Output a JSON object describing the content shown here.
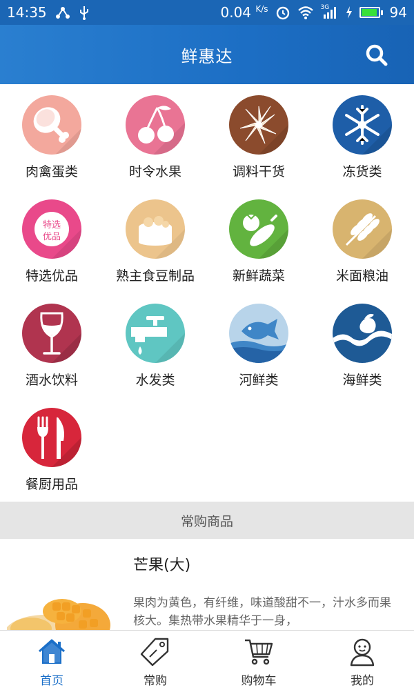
{
  "status_bar": {
    "time": "14:35",
    "net_speed": "0.04",
    "net_speed_unit": "K/s",
    "network": "3G",
    "battery": "94",
    "battery_level": 0.94,
    "icons": [
      "share-icon",
      "usb-icon",
      "alarm-icon",
      "wifi-icon",
      "signal-icon",
      "charging-icon",
      "battery-icon"
    ]
  },
  "header": {
    "title": "鲜惠达",
    "search_icon": "search-icon"
  },
  "categories": [
    {
      "label": "肉禽蛋类",
      "icon": "drumstick-icon",
      "color": "#f3a89d"
    },
    {
      "label": "时令水果",
      "icon": "cherry-icon",
      "color": "#e97494"
    },
    {
      "label": "调料干货",
      "icon": "star-anise-icon",
      "color": "#8b4b2d"
    },
    {
      "label": "冻货类",
      "icon": "snowflake-icon",
      "color": "#1e5ea8"
    },
    {
      "label": "特选优品",
      "icon": "premium-badge-icon",
      "color": "#e9498a",
      "badge_text": "特选优品"
    },
    {
      "label": "熟主食豆制品",
      "icon": "steamer-icon",
      "color": "#ecc48c"
    },
    {
      "label": "新鲜蔬菜",
      "icon": "vegetables-icon",
      "color": "#62b33f"
    },
    {
      "label": "米面粮油",
      "icon": "wheat-icon",
      "color": "#d8b46f"
    },
    {
      "label": "酒水饮料",
      "icon": "wine-glass-icon",
      "color": "#b0344f"
    },
    {
      "label": "水发类",
      "icon": "faucet-icon",
      "color": "#5fc6c2"
    },
    {
      "label": "河鲜类",
      "icon": "fish-icon",
      "color": "#b8d4ea"
    },
    {
      "label": "海鲜类",
      "icon": "wave-icon",
      "color": "#1e5a95"
    },
    {
      "label": "餐厨用品",
      "icon": "fork-knife-icon",
      "color": "#d7263b"
    }
  ],
  "section": {
    "title": "常购商品"
  },
  "product": {
    "name": "芒果(大)",
    "description": "果肉为黄色，有纤维，味道酸甜不一，汁水多而果核大。集热带水果精华于一身，"
  },
  "bottom_nav": [
    {
      "label": "首页",
      "icon": "home-icon",
      "active": true
    },
    {
      "label": "常购",
      "icon": "tag-icon",
      "active": false
    },
    {
      "label": "购物车",
      "icon": "cart-icon",
      "active": false
    },
    {
      "label": "我的",
      "icon": "user-icon",
      "active": false
    }
  ],
  "colors": {
    "primary": "#1b66b5",
    "active_nav": "#1b6fc8",
    "section_bg": "#e5e5e5"
  }
}
